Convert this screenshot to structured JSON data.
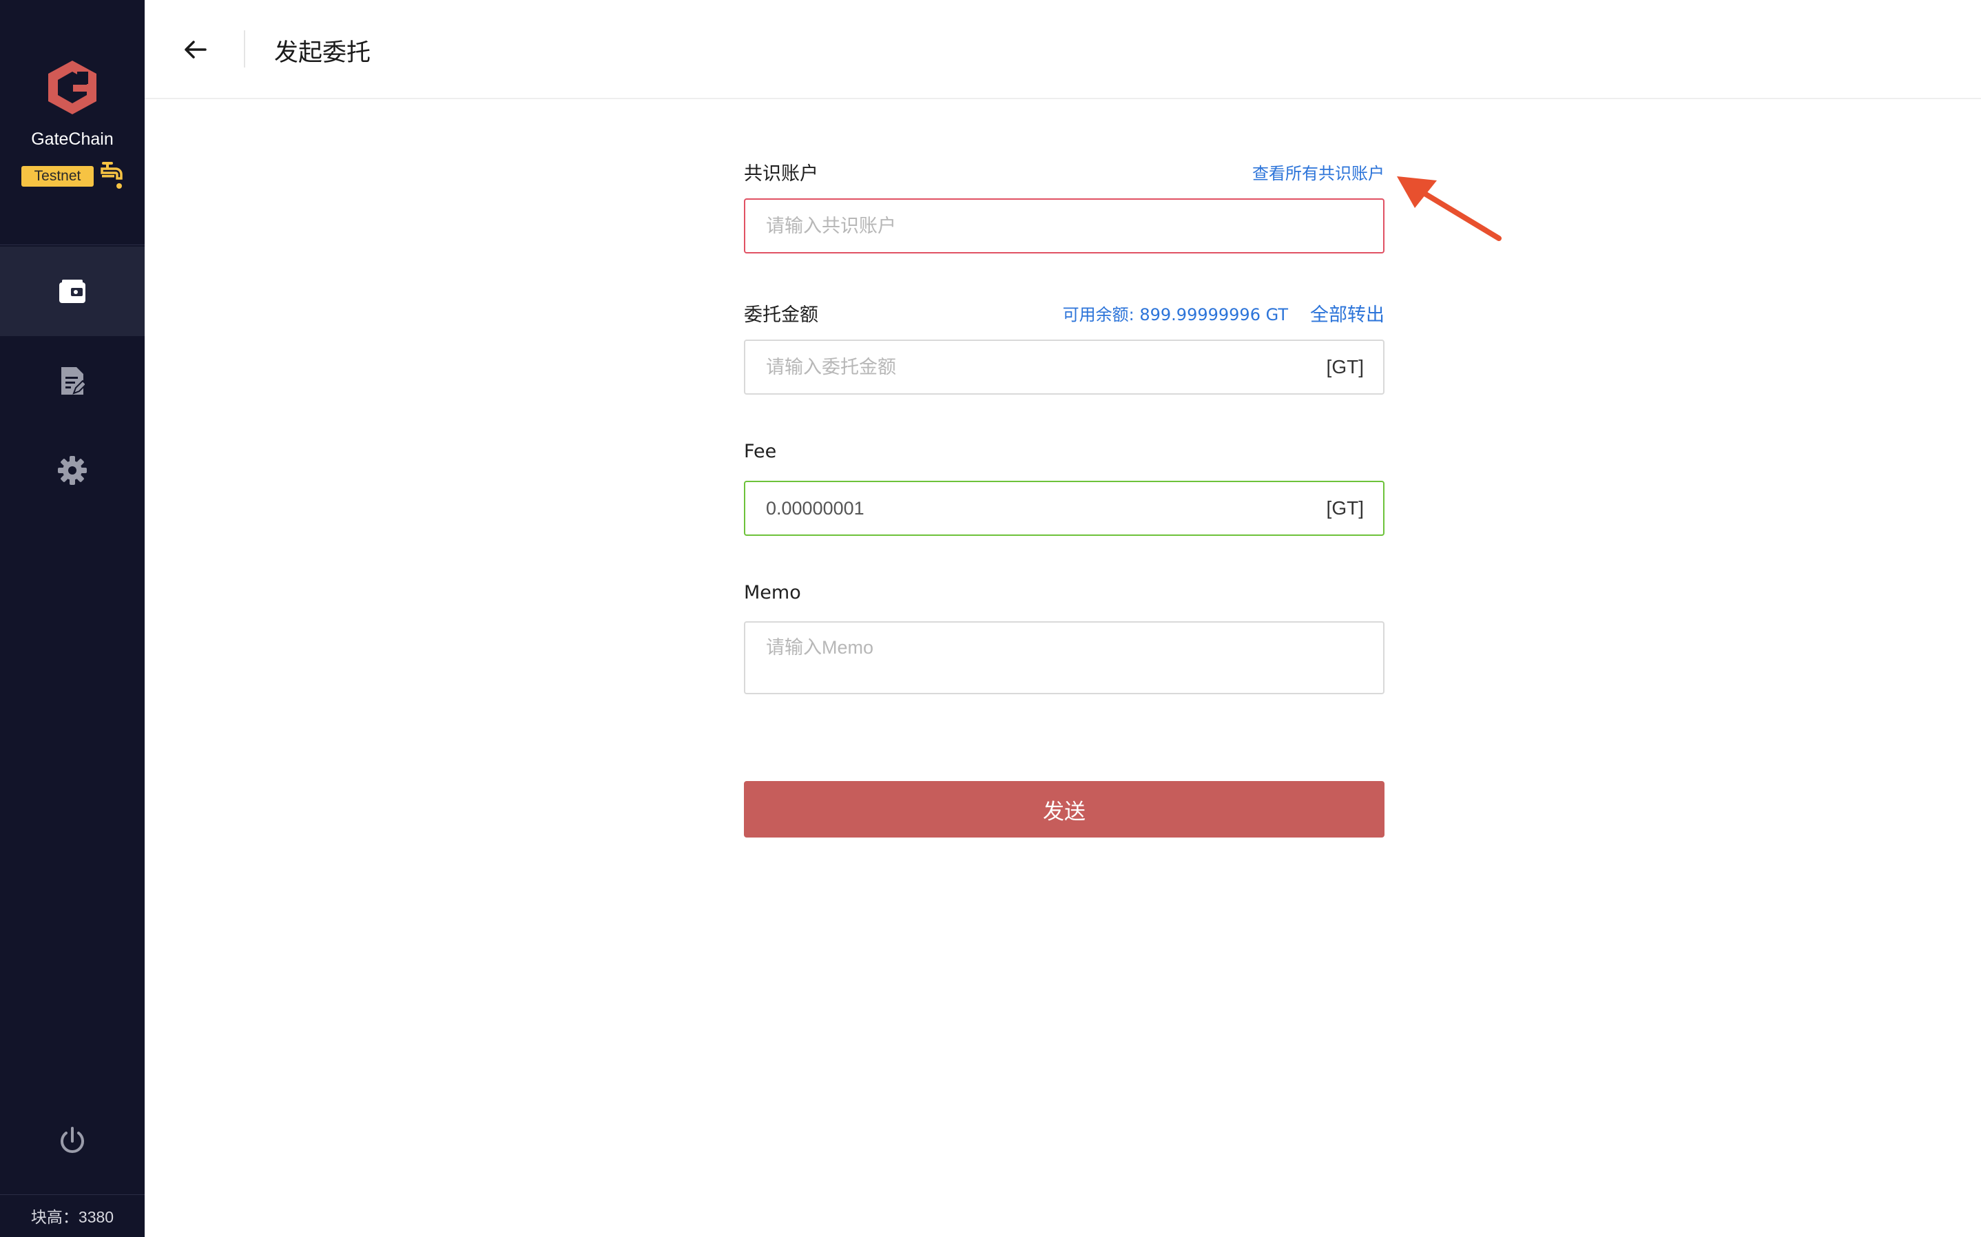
{
  "sidebar": {
    "brand_name": "GateChain",
    "network_badge": "Testnet",
    "nav_items": [
      {
        "icon": "wallet-icon",
        "active": true
      },
      {
        "icon": "document-edit-icon",
        "active": false
      },
      {
        "icon": "gear-icon",
        "active": false
      }
    ],
    "power_icon": "power-icon",
    "block_height": "块高：3380"
  },
  "header": {
    "back_icon": "arrow-left-icon",
    "title": "发起委托"
  },
  "form": {
    "consensus_account": {
      "label": "共识账户",
      "link": "查看所有共识账户",
      "placeholder": "请输入共识账户",
      "value": ""
    },
    "amount": {
      "label": "委托金额",
      "balance": "可用余额: 899.99999996 GT",
      "transfer_all": "全部转出",
      "placeholder": "请输入委托金额",
      "unit": "[GT]"
    },
    "fee": {
      "label": "Fee",
      "value": "0.00000001",
      "unit": "[GT]"
    },
    "memo": {
      "label": "Memo",
      "placeholder": "请输入Memo"
    },
    "submit_label": "发送"
  },
  "colors": {
    "sidebar_bg": "#121429",
    "accent_red": "#c65d5b",
    "link_blue": "#2c74d9",
    "error_border": "#e05163",
    "success_border": "#6dc23a",
    "badge_yellow": "#f6c343",
    "arrow": "#e8502e"
  }
}
